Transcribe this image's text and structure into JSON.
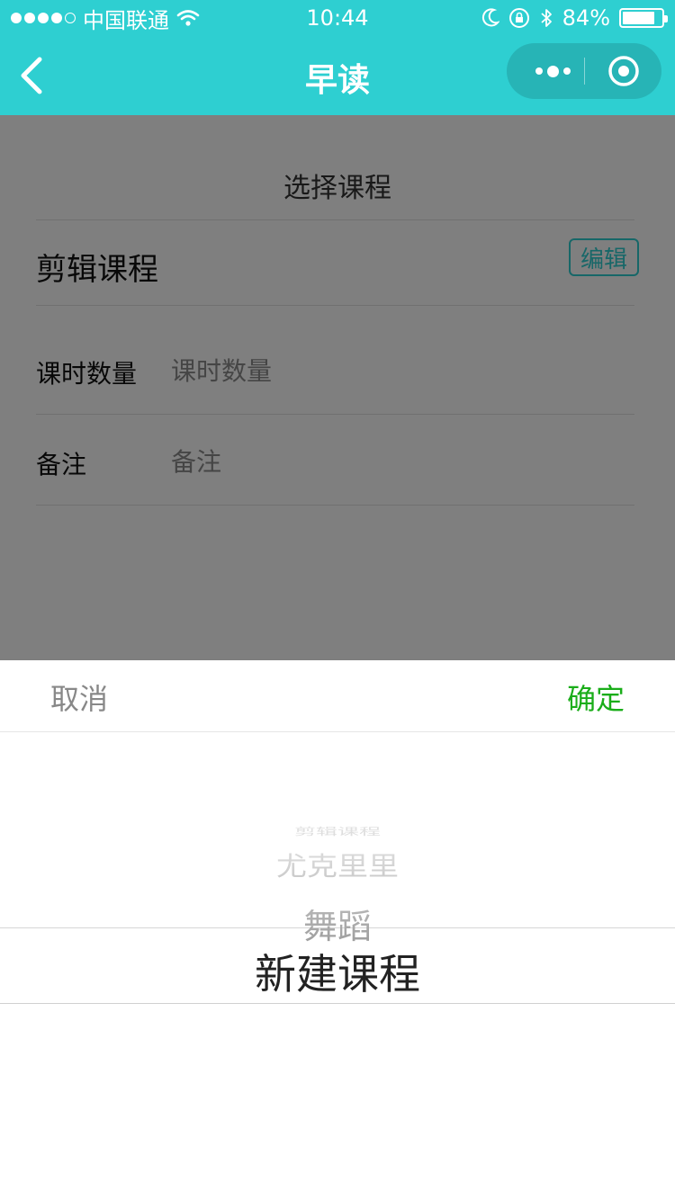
{
  "status_bar": {
    "carrier": "中国联通",
    "time": "10:44",
    "battery_percent": "84%",
    "battery_level": 0.84,
    "icons": [
      "signal-dots-icon",
      "wifi-icon",
      "moon-icon",
      "rotation-lock-icon",
      "bluetooth-icon",
      "battery-icon"
    ]
  },
  "nav": {
    "title": "早读",
    "back_icon": "chevron-left-icon",
    "more_icon": "more-dots-icon",
    "close_icon": "target-circle-icon"
  },
  "form": {
    "section_title": "选择课程",
    "course_name": "剪辑课程",
    "edit_label": "编辑",
    "lessons_label": "课时数量",
    "lessons_placeholder": "课时数量",
    "lessons_value": "",
    "note_label": "备注",
    "note_placeholder": "备注",
    "note_value": ""
  },
  "picker": {
    "cancel_label": "取消",
    "confirm_label": "确定",
    "items": [
      "剪辑课程",
      "尤克里里",
      "舞蹈",
      "新建课程"
    ],
    "selected_index": 3
  },
  "colors": {
    "accent": "#2ecfd1",
    "capsule": "#27b4b6",
    "confirm": "#1aad19",
    "mask": "rgba(0,0,0,0.5)"
  }
}
